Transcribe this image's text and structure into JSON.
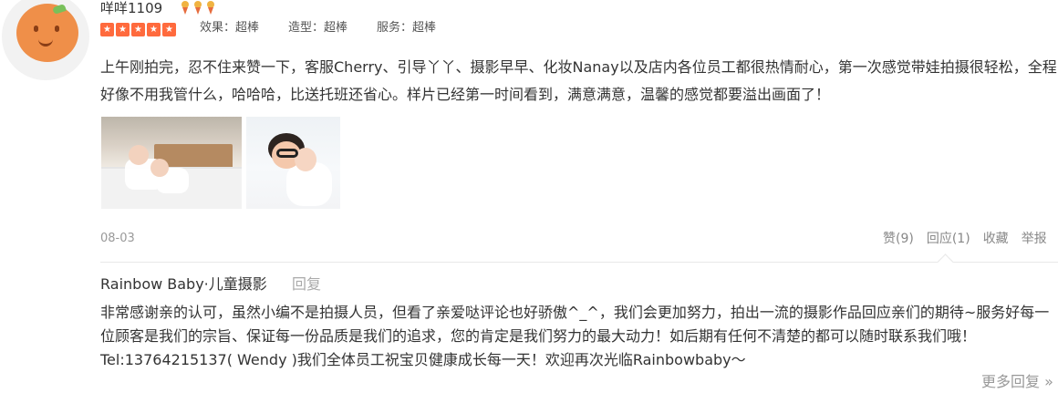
{
  "user": {
    "name": "咩咩1109",
    "avatar_icon": "orange-avatar-icon",
    "medals": [
      "medal-icon",
      "medal-icon",
      "medal-icon"
    ]
  },
  "rating": {
    "stars": 5,
    "items": [
      {
        "label": "效果：超棒"
      },
      {
        "label": "造型：超棒"
      },
      {
        "label": "服务：超棒"
      }
    ]
  },
  "review": {
    "text": "上午刚拍完，忍不住来赞一下，客服Cherry、引导丫丫、摄影早早、化妆Nanay以及店内各位员工都很热情耐心，第一次感觉带娃拍摄很轻松，全程好像不用我管什么，哈哈哈，比送托班还省心。样片已经第一时间看到，满意满意，温馨的感觉都要溢出画面了！",
    "photos": [
      {
        "name": "photo-kids-on-bed"
      },
      {
        "name": "photo-kids-with-glasses"
      }
    ],
    "date": "08-03"
  },
  "actions": {
    "like": "赞(9)",
    "reply": "回应(1)",
    "favorite": "收藏",
    "report": "举报"
  },
  "merchant_reply": {
    "merchant_name": "Rainbow Baby·儿童摄影",
    "tag": "回复",
    "text": "非常感谢亲的认可，虽然小编不是拍摄人员，但看了亲爱哒评论也好骄傲^_^，我们会更加努力，拍出一流的摄影作品回应亲们的期待~服务好每一位顾客是我们的宗旨、保证每一份品质是我们的追求，您的肯定是我们努力的最大动力！如后期有任何不清楚的都可以随时联系我们哦！Tel:13764215137( Wendy )我们全体员工祝宝贝健康成长每一天！欢迎再次光临Rainbowbaby～"
  },
  "more_replies": "更多回复 »",
  "colors": {
    "star": "#ff6a3d",
    "muted": "#999999",
    "text": "#333333"
  }
}
